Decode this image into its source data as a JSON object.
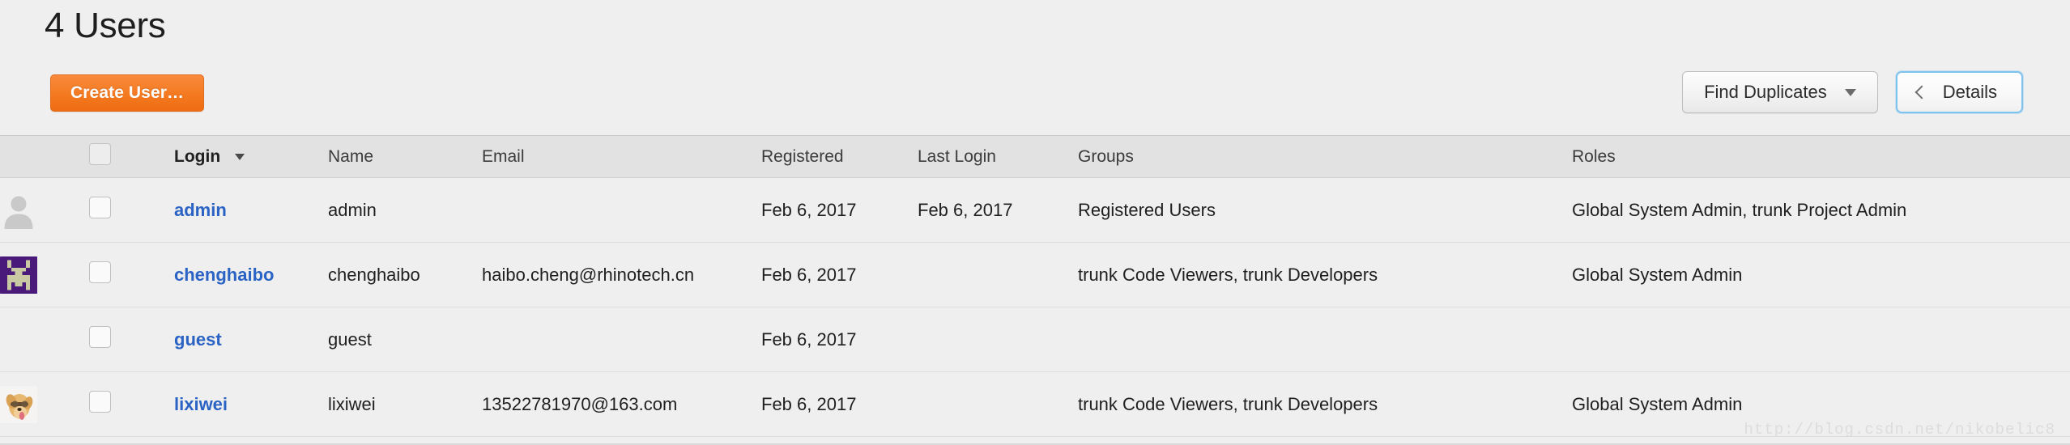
{
  "header": {
    "title": "4 Users",
    "create_user_label": "Create User…",
    "find_duplicates_label": "Find Duplicates",
    "details_label": "Details"
  },
  "table": {
    "columns": [
      {
        "key": "avatar",
        "label": ""
      },
      {
        "key": "checkbox",
        "label": ""
      },
      {
        "key": "login",
        "label": "Login"
      },
      {
        "key": "name",
        "label": "Name"
      },
      {
        "key": "email",
        "label": "Email"
      },
      {
        "key": "registered",
        "label": "Registered"
      },
      {
        "key": "last_login",
        "label": "Last Login"
      },
      {
        "key": "groups",
        "label": "Groups"
      },
      {
        "key": "roles",
        "label": "Roles"
      }
    ],
    "sorted_column": "Login",
    "sort_direction": "descending",
    "rows": [
      {
        "avatar_type": "default-person-icon",
        "login": "admin",
        "name": "admin",
        "email": "",
        "registered": "Feb 6, 2017",
        "last_login": "Feb 6, 2017",
        "groups": "Registered Users",
        "roles": "Global System Admin, trunk Project Admin"
      },
      {
        "avatar_type": "purple-identicon",
        "login": "chenghaibo",
        "name": "chenghaibo",
        "email": "haibo.cheng@rhinotech.cn",
        "registered": "Feb 6, 2017",
        "last_login": "",
        "groups": "trunk Code Viewers, trunk Developers",
        "roles": "Global System Admin"
      },
      {
        "avatar_type": "none",
        "login": "guest",
        "name": "guest",
        "email": "",
        "registered": "Feb 6, 2017",
        "last_login": "",
        "groups": "",
        "roles": ""
      },
      {
        "avatar_type": "dog-photo",
        "login": "lixiwei",
        "name": "lixiwei",
        "email": "13522781970@163.com",
        "registered": "Feb 6, 2017",
        "last_login": "",
        "groups": "trunk Code Viewers, trunk Developers",
        "roles": "Global System Admin"
      }
    ]
  },
  "watermark": "http://blog.csdn.net/nikobelic8",
  "colors": {
    "accent_orange": "#f47b22",
    "link_blue": "#2a63c4",
    "focus_blue": "#7ec2ee",
    "page_bg": "#efefef",
    "header_row_bg": "#e2e2e2",
    "identicon_purple": "#4a1a7a",
    "identicon_fg": "#c8c8a0"
  }
}
